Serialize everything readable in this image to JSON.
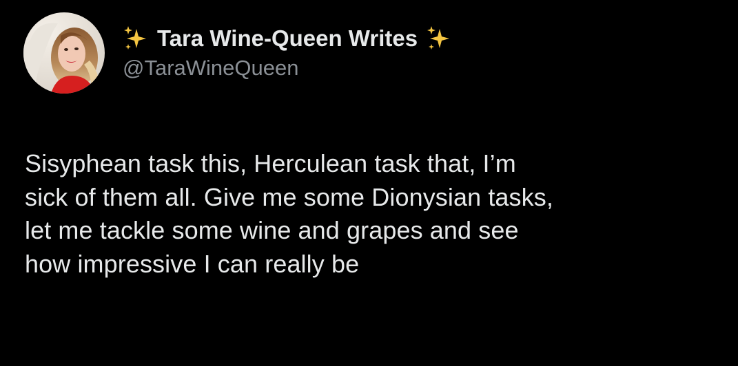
{
  "tweet": {
    "display_name": "Tara Wine-Queen Writes",
    "handle": "@TaraWineQueen",
    "leading_icon": "sparkles-icon",
    "trailing_icon": "sparkles-icon",
    "body_lines": [
      "Sisyphean task this, Herculean task that, I’m",
      "sick of them all. Give me some Dionysian tasks,",
      "let me tackle some wine and grapes and see",
      "how impressive I can really be"
    ]
  },
  "colors": {
    "background": "#000000",
    "text": "#e7e9ea",
    "handle": "#8b9096",
    "sparkle": "#f4c542"
  }
}
